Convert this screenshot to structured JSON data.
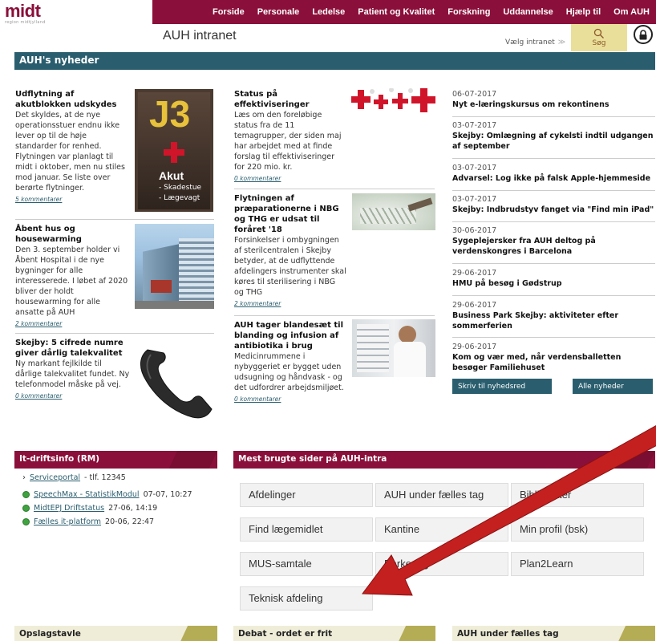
{
  "logo": {
    "main": "midt",
    "sub": "region midtjylland"
  },
  "nav": [
    "Forside",
    "Personale",
    "Ledelse",
    "Patient og Kvalitet",
    "Forskning",
    "Uddannelse",
    "Hjælp til",
    "Om AUH"
  ],
  "site_title": "AUH intranet",
  "intranet_select": "Vælg intranet",
  "search_label": "Søg",
  "news_header": "AUH's nyheder",
  "articles": [
    {
      "title": "Udflytning af akutblokken udskydes",
      "body": "Det skyldes, at de nye operationsstuer endnu ikke lever op til de høje standarder for renhed. Flytningen var planlagt til midt i oktober, men nu stiles mod januar. Se liste over berørte flytninger.",
      "comments": "5 kommentarer"
    },
    {
      "title": "Åbent hus og housewarming",
      "body": "Den 3. september holder vi Åbent Hospital i de nye bygninger for alle interesserede. I løbet af 2020 bliver der holdt housewarming for alle ansatte på AUH",
      "comments": "2 kommentarer"
    },
    {
      "title": "Skejby: 5 cifrede numre giver dårlig talekvalitet",
      "body": "Ny markant fejlkilde til dårlige talekvalitet fundet. Ny telefonmodel måske på vej.",
      "comments": "0 kommentarer"
    },
    {
      "title": "Status på effektiviseringer",
      "body": "Læs om den foreløbige status fra de 11 temagrupper, der siden maj har arbejdet med at finde forslag til effektiviseringer for 220 mio. kr.",
      "comments": "0 kommentarer"
    },
    {
      "title": "Flytningen af præparationerne i NBG og THG er udsat til foråret '18",
      "body": "Forsinkelser i ombygningen af sterilcentralen i Skejby betyder, at de udflyttende afdelingers instrumenter skal køres til sterilisering i NBG og THG",
      "comments": "2 kommentarer"
    },
    {
      "title": "AUH tager blandesæt til blanding og infusion af antibiotika i brug",
      "body": "Medicinrummene i nybyggeriet er bygget uden udsugning og håndvask - og det udfordrer arbejdsmiljøet.",
      "comments": "0 kommentarer"
    }
  ],
  "sign": {
    "code": "J3",
    "label1": "Akut",
    "label2": "- Skadestue",
    "label3": "- Lægevagt"
  },
  "side_news": [
    {
      "date": "06-07-2017",
      "title": "Nyt e-læringskursus om rekontinens"
    },
    {
      "date": "03-07-2017",
      "title": "Skejby: Omlægning af cykelsti indtil udgangen af september"
    },
    {
      "date": "03-07-2017",
      "title": "Advarsel: Log ikke på falsk Apple-hjemmeside"
    },
    {
      "date": "03-07-2017",
      "title": "Skejby: Indbrudstyv fanget via \"Find min iPad\""
    },
    {
      "date": "30-06-2017",
      "title": "Sygeplejersker fra AUH deltog på verdenskongres i Barcelona"
    },
    {
      "date": "29-06-2017",
      "title": "HMU på besøg i Gødstrup"
    },
    {
      "date": "29-06-2017",
      "title": "Business Park Skejby: aktiviteter efter sommerferien"
    },
    {
      "date": "29-06-2017",
      "title": "Kom og vær med, når verdensballetten besøger Familiehuset"
    }
  ],
  "side_buttons": {
    "write": "Skriv til nyhedsred",
    "all": "Alle nyheder"
  },
  "it": {
    "header": "It-driftsinfo (RM)",
    "serviceportal": "Serviceportal",
    "serviceportal_phone": " - tlf. 12345",
    "items": [
      {
        "link": "SpeechMax - StatistikModul",
        "time": "07-07, 10:27"
      },
      {
        "link": "MidtEPJ Driftstatus",
        "time": "27-06, 14:19"
      },
      {
        "link": "Fælles it-platform",
        "time": "20-06, 22:47"
      }
    ]
  },
  "most_used": {
    "header": "Mest brugte sider på AUH-intra",
    "buttons": [
      "Afdelinger",
      "AUH under fælles tag",
      "Bibliotekter",
      "Find lægemidlet",
      "Kantine",
      "Min profil (bsk)",
      "MUS-samtale",
      "Parkering",
      "Plan2Learn",
      "Teknisk afdeling"
    ]
  },
  "footer": [
    "Opslagstavle",
    "Debat - ordet er frit",
    "AUH under fælles tag"
  ],
  "colors": {
    "nav": "#8a0f3a",
    "teal": "#2a5e6e",
    "olive": "#b5ad55",
    "arrow": "#c42020"
  }
}
